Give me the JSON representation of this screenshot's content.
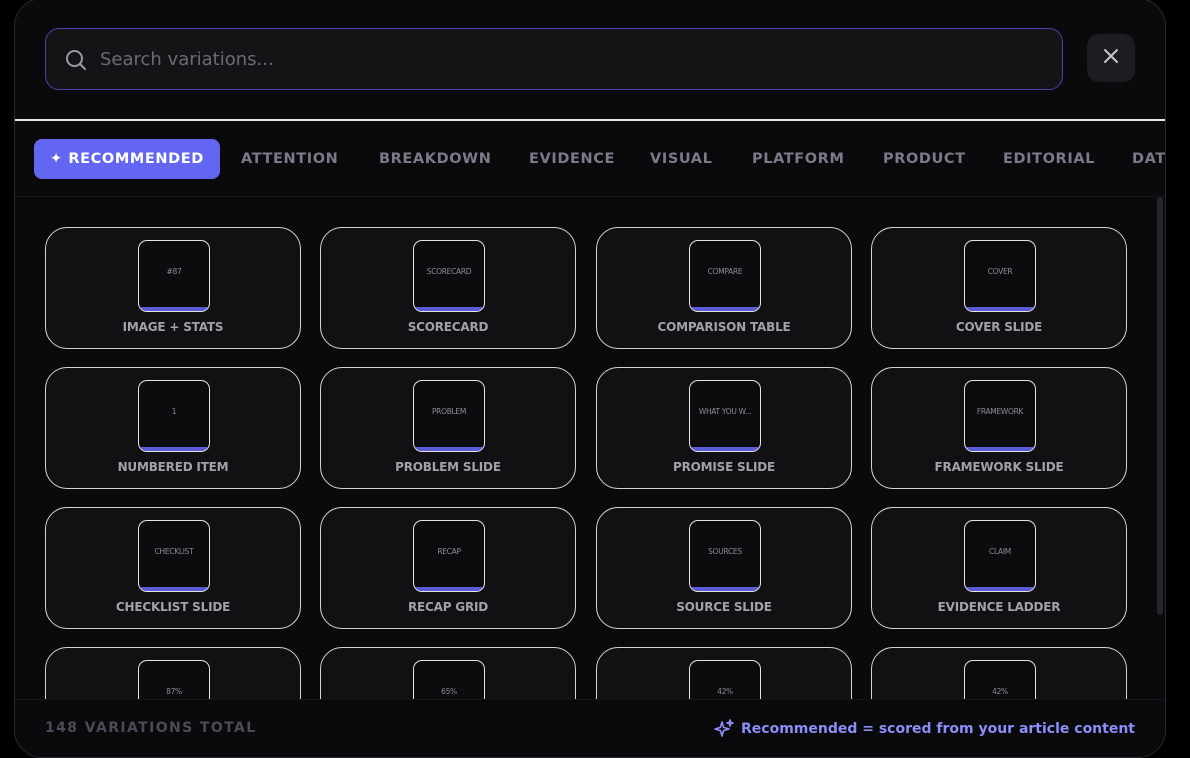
{
  "search": {
    "placeholder": "Search variations..."
  },
  "tabs": [
    {
      "label": "✦ RECOMMENDED",
      "active": true
    },
    {
      "label": "ATTENTION"
    },
    {
      "label": "BREAKDOWN"
    },
    {
      "label": "EVIDENCE"
    },
    {
      "label": "VISUAL"
    },
    {
      "label": "PLATFORM"
    },
    {
      "label": "PRODUCT"
    },
    {
      "label": "EDITORIAL"
    },
    {
      "label": "DAT"
    }
  ],
  "cards": [
    {
      "thumb": "#87",
      "label": "IMAGE + STATS"
    },
    {
      "thumb": "SCORECARD",
      "label": "SCORECARD"
    },
    {
      "thumb": "COMPARE",
      "label": "COMPARISON TABLE"
    },
    {
      "thumb": "COVER",
      "label": "COVER SLIDE"
    },
    {
      "thumb": "1",
      "label": "NUMBERED ITEM"
    },
    {
      "thumb": "PROBLEM",
      "label": "PROBLEM SLIDE"
    },
    {
      "thumb": "WHAT YOU W...",
      "label": "PROMISE SLIDE"
    },
    {
      "thumb": "FRAMEWORK",
      "label": "FRAMEWORK SLIDE"
    },
    {
      "thumb": "CHECKLIST",
      "label": "CHECKLIST SLIDE"
    },
    {
      "thumb": "RECAP",
      "label": "RECAP GRID"
    },
    {
      "thumb": "SOURCES",
      "label": "SOURCE SLIDE"
    },
    {
      "thumb": "CLAIM",
      "label": "EVIDENCE LADDER"
    },
    {
      "thumb": "87%",
      "label": ""
    },
    {
      "thumb": "65%",
      "label": ""
    },
    {
      "thumb": "42%",
      "label": ""
    },
    {
      "thumb": "42%",
      "label": ""
    }
  ],
  "footer": {
    "total": "148 VARIATIONS TOTAL",
    "note": "Recommended = scored from your article content"
  },
  "colors": {
    "accent": "#6366f1",
    "accent_text": "#8b8ef8",
    "background": "#0a0a0d"
  }
}
